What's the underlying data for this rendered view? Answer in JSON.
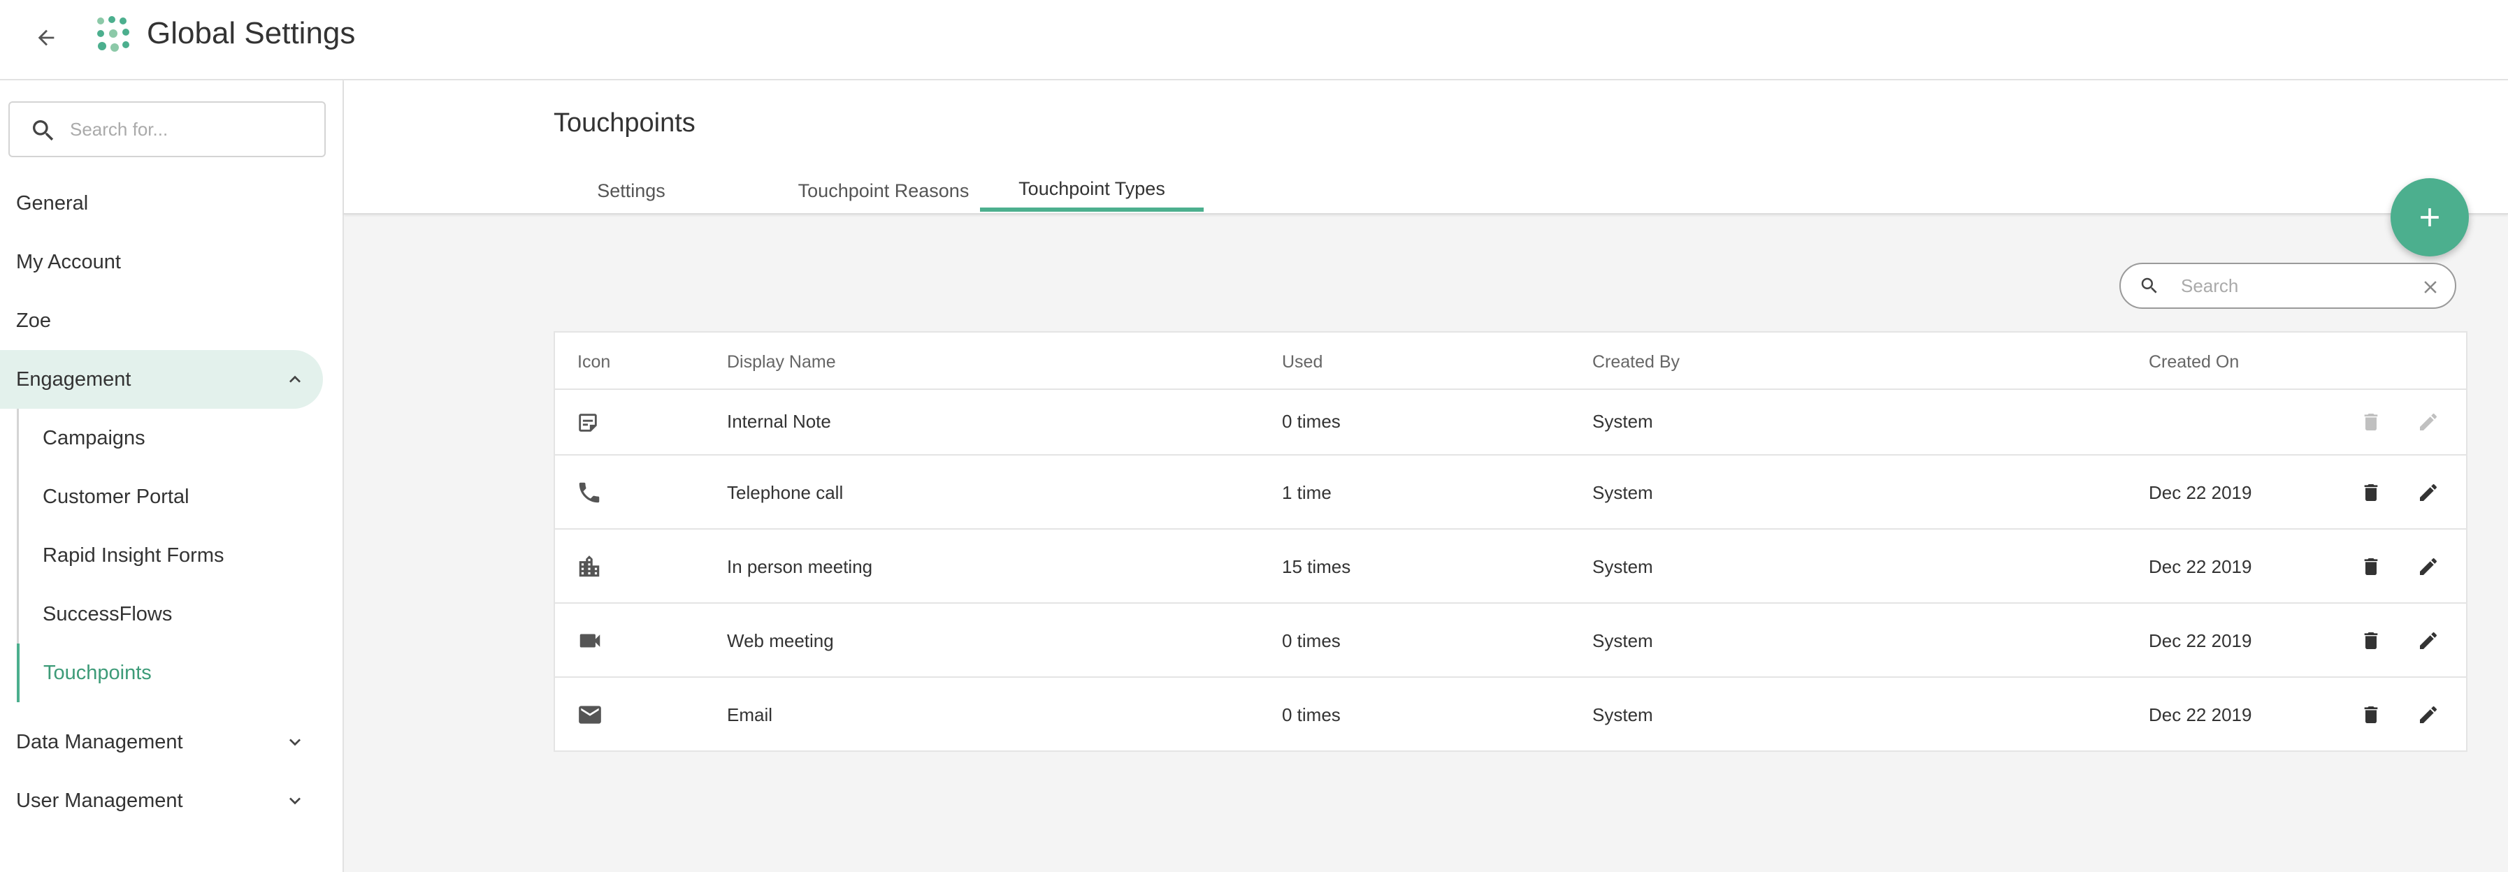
{
  "header": {
    "title": "Global Settings",
    "back_icon": "arrow-back-icon",
    "logo_icon": "app-logo-icon",
    "brand_color": "#4caf8e"
  },
  "sidebar": {
    "search_placeholder": "Search for...",
    "items": [
      {
        "label": "General"
      },
      {
        "label": "My Account"
      },
      {
        "label": "Zoe"
      },
      {
        "label": "Engagement",
        "expanded": true,
        "active": true
      },
      {
        "label": "Data Management",
        "expanded": false
      },
      {
        "label": "User Management",
        "expanded": false
      }
    ],
    "engagement_children": [
      {
        "label": "Campaigns"
      },
      {
        "label": "Customer Portal"
      },
      {
        "label": "Rapid Insight Forms"
      },
      {
        "label": "SuccessFlows"
      },
      {
        "label": "Touchpoints",
        "active": true
      }
    ]
  },
  "main": {
    "page_title": "Touchpoints",
    "tabs": [
      {
        "label": "Settings"
      },
      {
        "label": "Touchpoint Reasons"
      },
      {
        "label": "Touchpoint Types",
        "active": true
      }
    ],
    "add_button_icon": "plus-icon",
    "search_placeholder": "Search",
    "table": {
      "columns": [
        "Icon",
        "Display Name",
        "Used",
        "Created By",
        "Created On"
      ],
      "rows": [
        {
          "icon": "note-icon",
          "name": "Internal Note",
          "used": "0 times",
          "created_by": "System",
          "created_on": "",
          "actions_enabled": false
        },
        {
          "icon": "phone-icon",
          "name": "Telephone call",
          "used": "1 time",
          "created_by": "System",
          "created_on": "Dec 22 2019",
          "actions_enabled": true
        },
        {
          "icon": "building-icon",
          "name": "In person meeting",
          "used": "15 times",
          "created_by": "System",
          "created_on": "Dec 22 2019",
          "actions_enabled": true
        },
        {
          "icon": "video-camera-icon",
          "name": "Web meeting",
          "used": "0 times",
          "created_by": "System",
          "created_on": "Dec 22 2019",
          "actions_enabled": true
        },
        {
          "icon": "email-icon",
          "name": "Email",
          "used": "0 times",
          "created_by": "System",
          "created_on": "Dec 22 2019",
          "actions_enabled": true
        }
      ]
    }
  }
}
